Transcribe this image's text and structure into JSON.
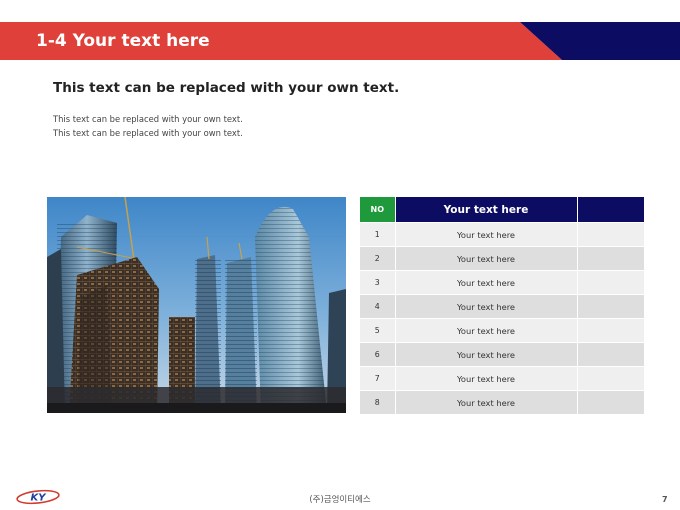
{
  "slide": {
    "title": "1-4 Your text here",
    "subtitle": "This text can be replaced with your own text.",
    "body_lines": [
      "This text can be replaced with your own text.",
      "This text can be replaced with your own text."
    ]
  },
  "photo": {
    "subject": "construction-skyscrapers"
  },
  "table": {
    "header": {
      "no": "NO",
      "text": "Your text here",
      "blank": ""
    },
    "rows": [
      {
        "no": "1",
        "text": "Your text here",
        "blank": ""
      },
      {
        "no": "2",
        "text": "Your text here",
        "blank": ""
      },
      {
        "no": "3",
        "text": "Your text here",
        "blank": ""
      },
      {
        "no": "4",
        "text": "Your text here",
        "blank": ""
      },
      {
        "no": "5",
        "text": "Your text here",
        "blank": ""
      },
      {
        "no": "6",
        "text": "Your text here",
        "blank": ""
      },
      {
        "no": "7",
        "text": "Your text here",
        "blank": ""
      },
      {
        "no": "8",
        "text": "Your text here",
        "blank": ""
      }
    ]
  },
  "footer": {
    "logo_text": "KY",
    "company": "(주)금엉이티에스",
    "page_number": "7"
  },
  "colors": {
    "header_red": "#e0403a",
    "header_navy": "#0c0c62",
    "table_header_green": "#1e9a3c",
    "row_light": "#efefef",
    "row_dark": "#dedede"
  }
}
